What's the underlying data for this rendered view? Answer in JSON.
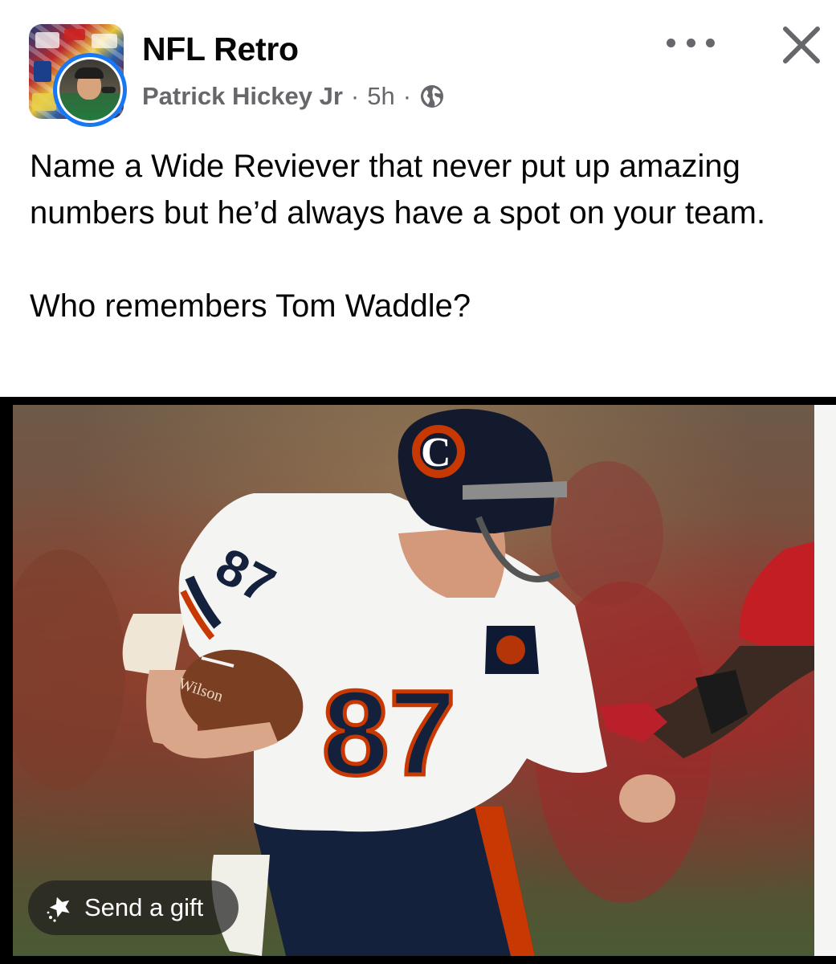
{
  "header": {
    "group_name": "NFL Retro",
    "author": "Patrick Hickey Jr",
    "separator": "·",
    "time": "5h",
    "audience_icon": "globe-icon",
    "more_icon": "more-horizontal-icon",
    "close_icon": "close-icon"
  },
  "post": {
    "text": "Name a Wide Reviever that never put up amazing numbers but he’d always have a spot on your team.\n\nWho remembers Tom Waddle?"
  },
  "photo": {
    "jersey_number": "87",
    "helmet_logo": "C",
    "ball_brand": "Wilson"
  },
  "gift": {
    "label": "Send a gift",
    "icon": "gift-sparkle-icon"
  },
  "colors": {
    "brand_blue": "#1877f2",
    "secondary_text": "#65676b",
    "primary_text": "#050505",
    "bears_navy": "#0b162a",
    "bears_orange": "#c83803"
  }
}
